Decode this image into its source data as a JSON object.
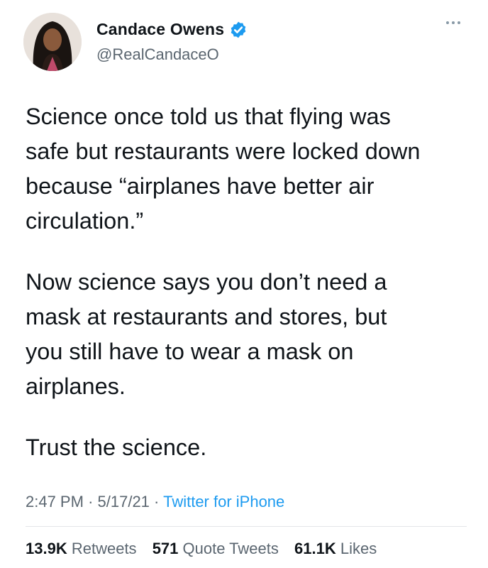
{
  "author": {
    "display_name": "Candace Owens",
    "handle": "@RealCandaceO",
    "verified_icon": "verified-badge-icon",
    "avatar": "profile-photo"
  },
  "tweet": {
    "paragraphs": [
      [
        "Science once told us that flying was",
        "safe but restaurants were locked down",
        "because “airplanes have better air",
        "circulation.”"
      ],
      [
        "Now science says you don’t need a",
        "mask at restaurants and stores, but",
        "you still have to wear a mask on",
        "airplanes."
      ],
      [
        "Trust the science."
      ]
    ],
    "time": "2:47 PM",
    "date": "5/17/21",
    "separator": "·",
    "source": "Twitter for iPhone"
  },
  "stats": {
    "retweets_count": "13.9K",
    "retweets_label": "Retweets",
    "quotes_count": "571",
    "quotes_label": "Quote Tweets",
    "likes_count": "61.1K",
    "likes_label": "Likes"
  },
  "colors": {
    "accent": "#1d9bf0",
    "text": "#0f1419",
    "muted": "#5b6670"
  }
}
